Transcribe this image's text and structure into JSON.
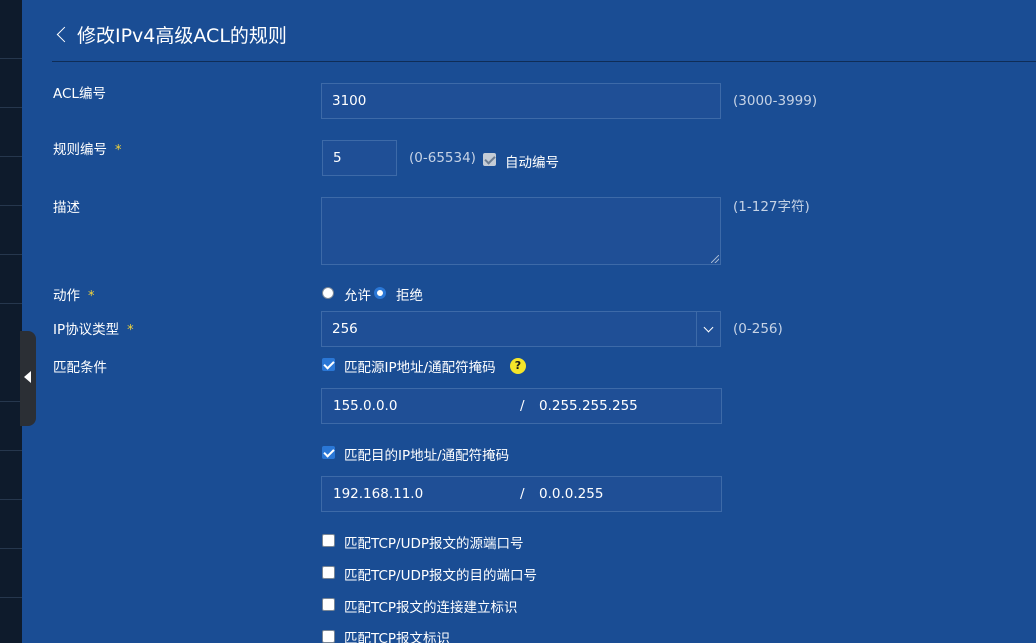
{
  "header": {
    "title": "修改IPv4高级ACL的规则"
  },
  "acl_number": {
    "label": "ACL编号",
    "value": "3100",
    "hint": "(3000-3999)"
  },
  "rule_number": {
    "label": "规则编号",
    "required_mark": "*",
    "value": "5",
    "hint": "(0-65534)",
    "auto_label": "自动编号",
    "auto_checked": true
  },
  "description": {
    "label": "描述",
    "value": "",
    "hint": "(1-127字符)"
  },
  "action": {
    "label": "动作",
    "required_mark": "*",
    "options": [
      "允许",
      "拒绝"
    ],
    "selected": "拒绝"
  },
  "protocol": {
    "label": "IP协议类型",
    "required_mark": "*",
    "value": "256",
    "hint": "(0-256)"
  },
  "match": {
    "label": "匹配条件",
    "source": {
      "label": "匹配源IP地址/通配符掩码",
      "checked": true,
      "help": "?",
      "ip": "155.0.0.0",
      "sep": "/",
      "mask": "0.255.255.255"
    },
    "dest": {
      "label": "匹配目的IP地址/通配符掩码",
      "checked": true,
      "ip": "192.168.11.0",
      "sep": "/",
      "mask": "0.0.0.255"
    },
    "options": [
      {
        "label": "匹配TCP/UDP报文的源端口号",
        "checked": false
      },
      {
        "label": "匹配TCP/UDP报文的目的端口号",
        "checked": false
      },
      {
        "label": "匹配TCP报文的连接建立标识",
        "checked": false
      },
      {
        "label": "匹配TCP报文标识",
        "checked": false
      }
    ]
  }
}
